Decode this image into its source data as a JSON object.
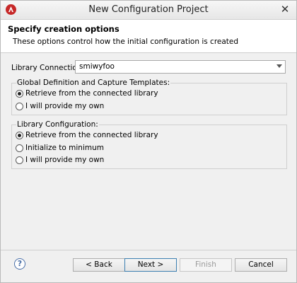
{
  "window": {
    "title": "New Configuration Project",
    "close_glyph": "✕",
    "app_icon": "app-logo-icon"
  },
  "banner": {
    "title": "Specify creation options",
    "description": "These options control how the initial configuration is created"
  },
  "library_connection": {
    "label": "Library Connection:",
    "value": "smiwyfoo"
  },
  "global_group": {
    "label": "Global Definition and Capture Templates:",
    "options": [
      {
        "label": "Retrieve from the connected library",
        "checked": true
      },
      {
        "label": "I will provide my own",
        "checked": false
      }
    ]
  },
  "library_group": {
    "label": "Library Configuration:",
    "options": [
      {
        "label": "Retrieve from the connected library",
        "checked": true
      },
      {
        "label": "Initialize to minimum",
        "checked": false
      },
      {
        "label": "I will provide my own",
        "checked": false
      }
    ]
  },
  "footer": {
    "help_glyph": "?",
    "back": "< Back",
    "next": "Next >",
    "finish": "Finish",
    "cancel": "Cancel"
  }
}
